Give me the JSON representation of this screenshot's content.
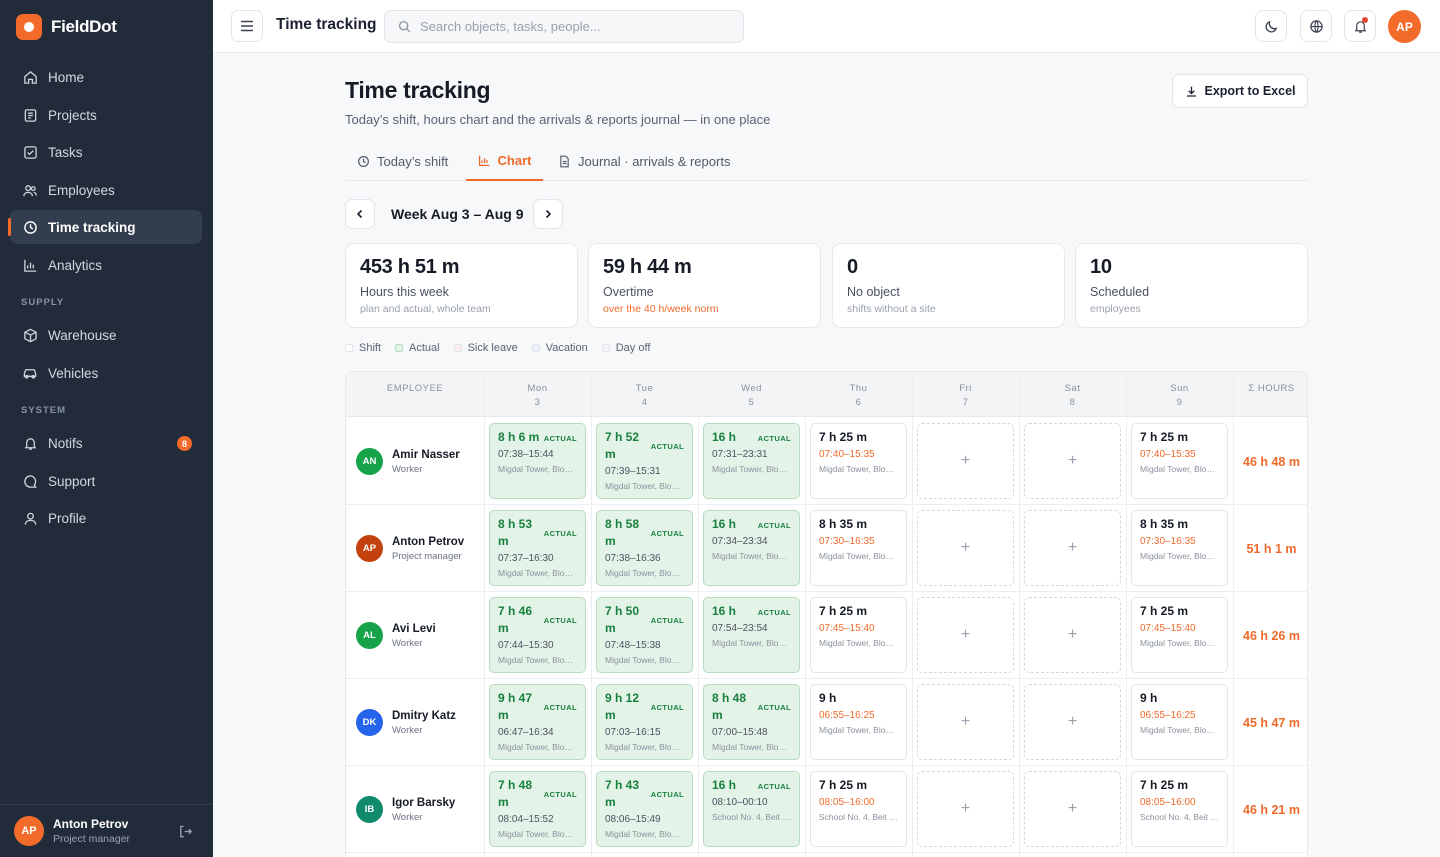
{
  "brand": {
    "name": "FieldDot"
  },
  "sidebar": {
    "items": [
      {
        "label": "Home",
        "icon": "home-icon"
      },
      {
        "label": "Projects",
        "icon": "projects-icon"
      },
      {
        "label": "Tasks",
        "icon": "tasks-icon"
      },
      {
        "label": "Employees",
        "icon": "employees-icon"
      },
      {
        "label": "Time tracking",
        "icon": "clock-icon",
        "active": true
      },
      {
        "label": "Analytics",
        "icon": "analytics-icon"
      }
    ],
    "supply_title": "SUPPLY",
    "supply_items": [
      {
        "label": "Warehouse",
        "icon": "warehouse-icon"
      },
      {
        "label": "Vehicles",
        "icon": "vehicle-icon"
      }
    ],
    "system_title": "SYSTEM",
    "system_items": [
      {
        "label": "Notifs",
        "icon": "bell-icon",
        "badge": "8"
      },
      {
        "label": "Support",
        "icon": "support-icon"
      },
      {
        "label": "Profile",
        "icon": "profile-icon"
      }
    ],
    "user": {
      "initials": "AP",
      "name": "Anton Petrov",
      "role": "Project manager"
    }
  },
  "topbar": {
    "title": "Time tracking",
    "search_placeholder": "Search objects, tasks, people...",
    "avatar": "AP"
  },
  "page": {
    "title": "Time tracking",
    "subtitle": "Today’s shift, hours chart and the arrivals & reports journal — in one place",
    "export_label": "Export to Excel"
  },
  "tabs": [
    {
      "label": "Today’s shift",
      "icon": "clock-icon"
    },
    {
      "label": "Chart",
      "icon": "bar-chart-icon",
      "active": true
    },
    {
      "label": "Journal · arrivals & reports",
      "icon": "document-icon"
    }
  ],
  "week": {
    "label": "Week Aug 3 – Aug 9"
  },
  "stats": [
    {
      "value": "453 h 51 m",
      "label": "Hours this week",
      "hint": "plan and actual, whole team"
    },
    {
      "value": "59 h 44 m",
      "label": "Overtime",
      "hint": "over the 40 h/week norm",
      "warn": true
    },
    {
      "value": "0",
      "label": "No object",
      "hint": "shifts without a site"
    },
    {
      "value": "10",
      "label": "Scheduled",
      "hint": "employees"
    }
  ],
  "legend": [
    {
      "label": "Shift",
      "color": "#ffffff"
    },
    {
      "label": "Actual",
      "color": "#e4f3e8"
    },
    {
      "label": "Sick leave",
      "color": "#fdeeee"
    },
    {
      "label": "Vacation",
      "color": "#eef1fb"
    },
    {
      "label": "Day off",
      "color": "#f3f4f6"
    }
  ],
  "grid": {
    "employee_header": "EMPLOYEE",
    "total_header": "Σ HOURS",
    "days": [
      {
        "name": "Mon",
        "num": "3"
      },
      {
        "name": "Tue",
        "num": "4"
      },
      {
        "name": "Wed",
        "num": "5"
      },
      {
        "name": "Thu",
        "num": "6"
      },
      {
        "name": "Fri",
        "num": "7"
      },
      {
        "name": "Sat",
        "num": "8"
      },
      {
        "name": "Sun",
        "num": "9"
      }
    ],
    "actual_tag": "ACTUAL",
    "add_symbol": "+",
    "rows": [
      {
        "initials": "AN",
        "name": "Amir Nasser",
        "role": "Worker",
        "avatar_color": "#16a34a",
        "total": "46 h 48 m",
        "cells": [
          {
            "type": "act",
            "hours": "8 h 6 m",
            "time": "07:38–15:44",
            "loc": "Migdal Tower, Block A"
          },
          {
            "type": "act",
            "hours": "7 h 52 m",
            "time": "07:39–15:31",
            "loc": "Migdal Tower, Block A"
          },
          {
            "type": "act",
            "hours": "16 h",
            "time": "07:31–23:31",
            "loc": "Migdal Tower, Block A"
          },
          {
            "type": "sch",
            "hours": "7 h 25 m",
            "time": "07:40–15:35",
            "loc": "Migdal Tower, Block A"
          },
          {
            "type": "empty"
          },
          {
            "type": "empty"
          },
          {
            "type": "sch",
            "hours": "7 h 25 m",
            "time": "07:40–15:35",
            "loc": "Migdal Tower, Block A"
          }
        ]
      },
      {
        "initials": "AP",
        "name": "Anton Petrov",
        "role": "Project manager",
        "avatar_color": "#c2410c",
        "total": "51 h 1 m",
        "cells": [
          {
            "type": "act",
            "hours": "8 h 53 m",
            "time": "07:37–16:30",
            "loc": "Migdal Tower, Block A"
          },
          {
            "type": "act",
            "hours": "8 h 58 m",
            "time": "07:38–16:36",
            "loc": "Migdal Tower, Block A"
          },
          {
            "type": "act",
            "hours": "16 h",
            "time": "07:34–23:34",
            "loc": "Migdal Tower, Block A"
          },
          {
            "type": "sch",
            "hours": "8 h 35 m",
            "time": "07:30–16:35",
            "loc": "Migdal Tower, Block A"
          },
          {
            "type": "empty"
          },
          {
            "type": "empty"
          },
          {
            "type": "sch",
            "hours": "8 h 35 m",
            "time": "07:30–16:35",
            "loc": "Migdal Tower, Block A"
          }
        ]
      },
      {
        "initials": "AL",
        "name": "Avi Levi",
        "role": "Worker",
        "avatar_color": "#16a34a",
        "total": "46 h 26 m",
        "cells": [
          {
            "type": "act",
            "hours": "7 h 46 m",
            "time": "07:44–15:30",
            "loc": "Migdal Tower, Block A"
          },
          {
            "type": "act",
            "hours": "7 h 50 m",
            "time": "07:48–15:38",
            "loc": "Migdal Tower, Block A"
          },
          {
            "type": "act",
            "hours": "16 h",
            "time": "07:54–23:54",
            "loc": "Migdal Tower, Block A"
          },
          {
            "type": "sch",
            "hours": "7 h 25 m",
            "time": "07:45–15:40",
            "loc": "Migdal Tower, Block A"
          },
          {
            "type": "empty"
          },
          {
            "type": "empty"
          },
          {
            "type": "sch",
            "hours": "7 h 25 m",
            "time": "07:45–15:40",
            "loc": "Migdal Tower, Block A"
          }
        ]
      },
      {
        "initials": "DK",
        "name": "Dmitry Katz",
        "role": "Worker",
        "avatar_color": "#2563eb",
        "total": "45 h 47 m",
        "cells": [
          {
            "type": "act",
            "hours": "9 h 47 m",
            "time": "06:47–16:34",
            "loc": "Migdal Tower, Block A"
          },
          {
            "type": "act",
            "hours": "9 h 12 m",
            "time": "07:03–16:15",
            "loc": "Migdal Tower, Block A"
          },
          {
            "type": "act",
            "hours": "8 h 48 m",
            "time": "07:00–15:48",
            "loc": "Migdal Tower, Block A"
          },
          {
            "type": "sch",
            "hours": "9 h",
            "time": "06:55–16:25",
            "loc": "Migdal Tower, Block A"
          },
          {
            "type": "empty"
          },
          {
            "type": "empty"
          },
          {
            "type": "sch",
            "hours": "9 h",
            "time": "06:55–16:25",
            "loc": "Migdal Tower, Block A"
          }
        ]
      },
      {
        "initials": "IB",
        "name": "Igor Barsky",
        "role": "Worker",
        "avatar_color": "#0f8a6a",
        "total": "46 h 21 m",
        "cells": [
          {
            "type": "act",
            "hours": "7 h 48 m",
            "time": "08:04–15:52",
            "loc": "Migdal Tower, Block A"
          },
          {
            "type": "act",
            "hours": "7 h 43 m",
            "time": "08:06–15:49",
            "loc": "Migdal Tower, Block A"
          },
          {
            "type": "act",
            "hours": "16 h",
            "time": "08:10–00:10",
            "loc": "School No. 4, Beit Shemesh"
          },
          {
            "type": "sch",
            "hours": "7 h 25 m",
            "time": "08:05–16:00",
            "loc": "School No. 4, Beit Shemesh"
          },
          {
            "type": "empty"
          },
          {
            "type": "empty"
          },
          {
            "type": "sch",
            "hours": "7 h 25 m",
            "time": "08:05–16:00",
            "loc": "School No. 4, Beit Shemesh"
          }
        ]
      }
    ]
  }
}
